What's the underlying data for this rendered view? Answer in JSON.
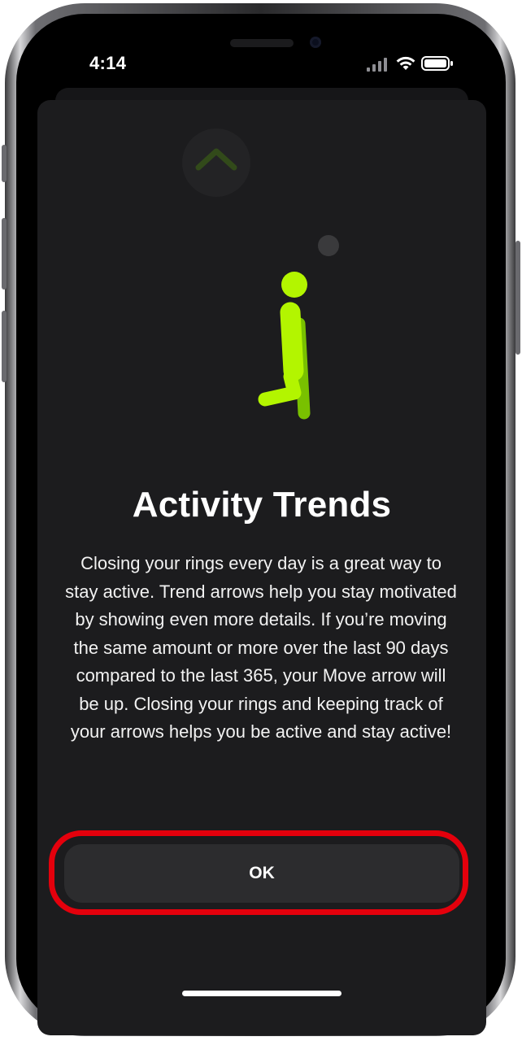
{
  "status_bar": {
    "time": "4:14",
    "icons": [
      "cellular-signal-icon",
      "wifi-icon",
      "battery-icon"
    ]
  },
  "onboarding": {
    "illustration": "walking-figure-icon",
    "trend_icon": "up-arrow-icon",
    "title": "Activity Trends",
    "body": "Closing your rings every day is a great way to stay active. Trend arrows help you stay motivated by showing even more details. If you’re moving the same amount or more over the last 90 days compared to the last 365, your Move arrow will be up. Closing your rings and keeping track of your arrows helps you be active and stay active!",
    "ok_label": "OK"
  },
  "colors": {
    "accent_green": "#B3F500",
    "highlight_red": "#E4000C",
    "sheet_background": "#1C1C1E",
    "button_background": "#2C2C2E"
  }
}
